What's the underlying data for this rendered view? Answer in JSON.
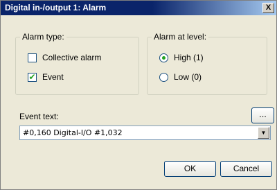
{
  "window": {
    "title": "Digital in-/output 1: Alarm",
    "close_label": "X"
  },
  "alarm_type": {
    "legend": "Alarm type:",
    "options": [
      {
        "label": "Collective alarm",
        "checked": false
      },
      {
        "label": "Event",
        "checked": true
      }
    ]
  },
  "alarm_level": {
    "legend": "Alarm at level:",
    "options": [
      {
        "label": "High (1)",
        "selected": true
      },
      {
        "label": "Low (0)",
        "selected": false
      }
    ]
  },
  "event_text": {
    "label": "Event text:",
    "browse_label": "...",
    "value": "#0,160 Digital-I/O #1,032"
  },
  "buttons": {
    "ok": "OK",
    "cancel": "Cancel"
  },
  "colors": {
    "title_bar": "#0a246a",
    "dialog_bg": "#ece9d8",
    "check_mark": "#21a121"
  }
}
